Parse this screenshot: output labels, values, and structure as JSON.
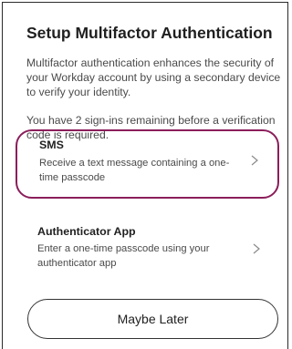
{
  "dialog": {
    "title": "Setup Multifactor Authentication",
    "intro": "Multifactor authentication enhances the security of your Workday account by using a secondary device to verify your identity.",
    "remaining": "You have 2 sign-ins remaining before a verification code is required."
  },
  "options": [
    {
      "title": "SMS",
      "description": "Receive a text message containing a one-time passcode",
      "icon": "chevron-right-icon",
      "selected": true
    },
    {
      "title": "Authenticator App",
      "description": "Enter a one-time passcode using your authenticator app",
      "icon": "chevron-right-icon",
      "selected": false
    }
  ],
  "actions": {
    "maybe_later_label": "Maybe Later"
  },
  "colors": {
    "highlight": "#8b1e5b",
    "text_primary": "#1f1f1f",
    "text_secondary": "#4a4a4a"
  }
}
